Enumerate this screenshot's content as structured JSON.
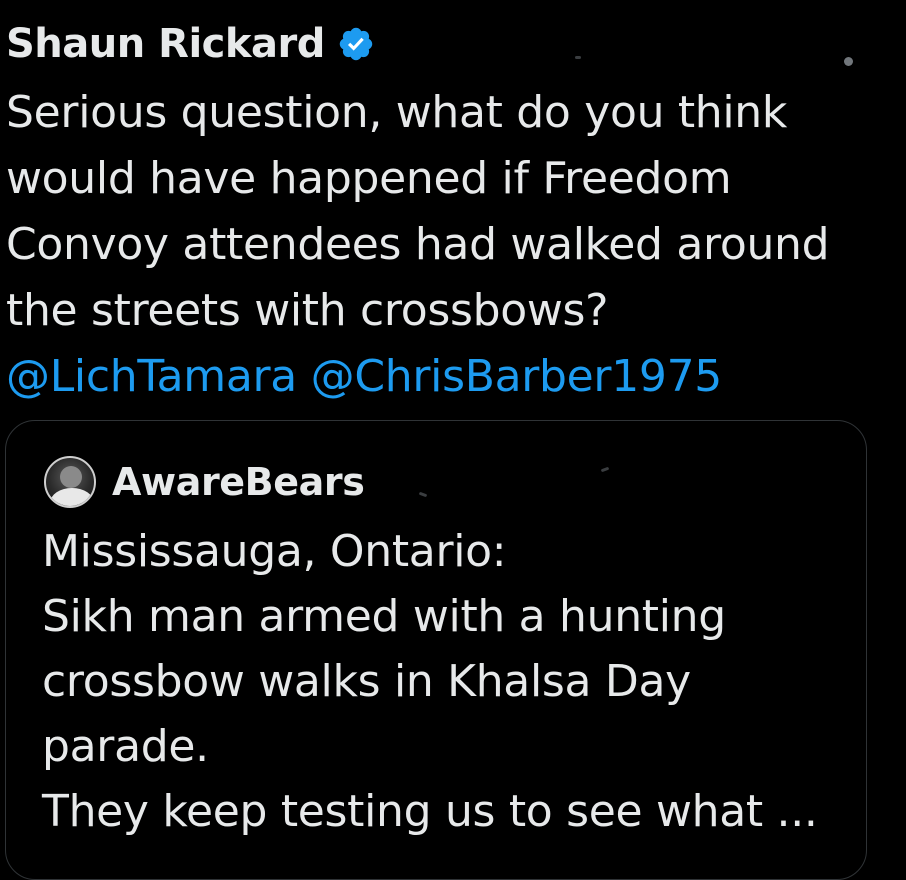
{
  "tweet": {
    "author_name": "Shaun Rickard",
    "verified_icon": "verified-badge-icon",
    "text_lines": [
      "Serious question, what do you think",
      "would have happened if Freedom",
      "Convoy attendees had walked around",
      "the streets with crossbows?"
    ],
    "mentions": [
      "@LichTamara",
      "@ChrisBarber1975"
    ]
  },
  "quoted_tweet": {
    "author_name": "AwareBears",
    "text_lines": [
      "Mississauga, Ontario:",
      "Sikh man armed with a hunting",
      "crossbow walks in Khalsa Day",
      "parade.",
      "They keep testing us to see what ..."
    ]
  },
  "colors": {
    "background": "#000000",
    "text": "#e7e9ea",
    "link": "#1d9bf0",
    "verified": "#1d9bf0",
    "border": "#2f3336"
  }
}
